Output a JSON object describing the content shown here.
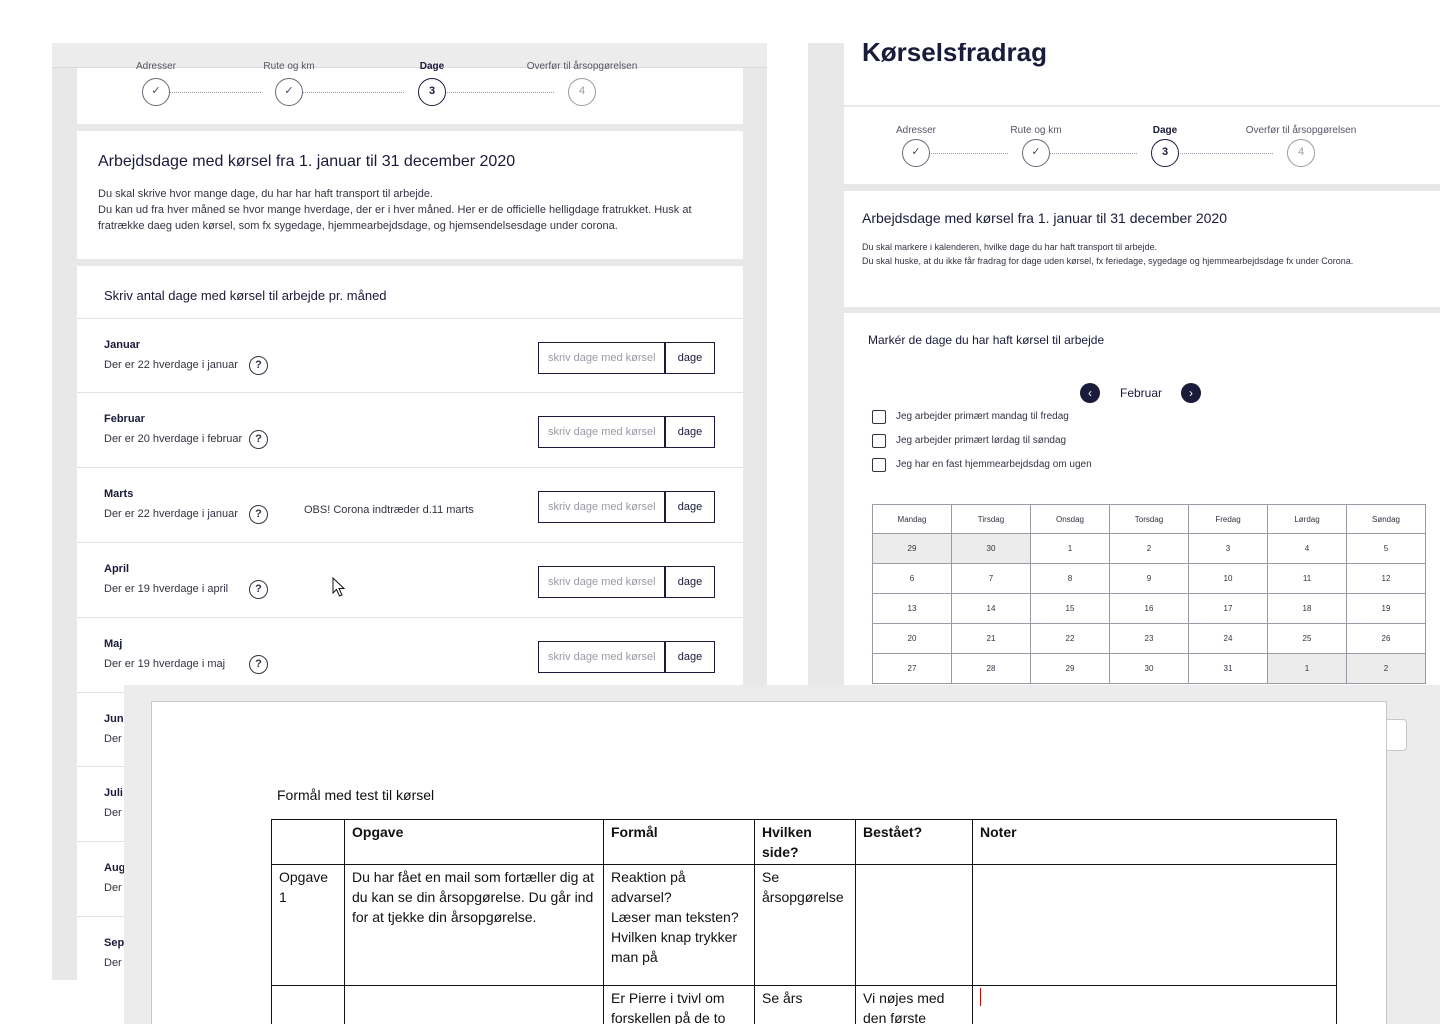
{
  "left": {
    "steps": [
      {
        "label": "Adresser",
        "marker": "✓",
        "state": "done"
      },
      {
        "label": "Rute og km",
        "marker": "✓",
        "state": "done"
      },
      {
        "label": "Dage",
        "marker": "3",
        "state": "current"
      },
      {
        "label": "Overfør til årsopgørelsen",
        "marker": "4",
        "state": "future"
      }
    ],
    "intro_title": "Arbejdsdage med kørsel fra 1. januar til 31 december 2020",
    "intro_line1": "Du skal skrive hvor mange dage, du har har haft transport til arbejde.",
    "intro_line2": "Du kan ud fra hver måned se hvor mange hverdage, der er i hver måned. Her er de officielle helligdage fratrukket. Husk at fratrække daeg uden kørsel, som fx sygedage, hjemmearbejdsdage, og hjemsendelsesdage under corona.",
    "form_title": "Skriv antal dage med kørsel til arbejde pr. måned",
    "input_placeholder": "skriv dage med kørsel",
    "unit_label": "dage",
    "help_glyph": "?",
    "months": [
      {
        "name": "Januar",
        "sub": "Der er 22 hverdage i januar"
      },
      {
        "name": "Februar",
        "sub": "Der er 20 hverdage i februar"
      },
      {
        "name": "Marts",
        "sub": "Der er 22 hverdage i januar",
        "note": "OBS! Corona indtræder d.11 marts"
      },
      {
        "name": "April",
        "sub": "Der er 19 hverdage i april"
      },
      {
        "name": "Maj",
        "sub": "Der er 19 hverdage i maj"
      },
      {
        "name": "Juni",
        "sub": "Der"
      },
      {
        "name": "Juli",
        "sub": "Der"
      },
      {
        "name": "Aug",
        "sub": "Der"
      },
      {
        "name": "Sept",
        "sub": "Der"
      }
    ]
  },
  "right": {
    "page_title": "Kørselsfradrag",
    "steps": [
      {
        "label": "Adresser",
        "marker": "✓",
        "state": "done"
      },
      {
        "label": "Rute og km",
        "marker": "✓",
        "state": "done"
      },
      {
        "label": "Dage",
        "marker": "3",
        "state": "current"
      },
      {
        "label": "Overfør til årsopgørelsen",
        "marker": "4",
        "state": "future"
      }
    ],
    "intro_title": "Arbejdsdage med kørsel fra 1. januar til 31 december 2020",
    "intro_line1": "Du skal markere i kalenderen, hvilke dage du har haft transport til arbejde.",
    "intro_line2": "Du skal huske, at du ikke får fradrag for dage uden kørsel, fx feriedage, sygedage og hjemmearbejdsdage fx under Corona.",
    "calendar_title": "Markér de dage du har haft kørsel til arbejde",
    "month": "Februar",
    "prev_glyph": "‹",
    "next_glyph": "›",
    "options": [
      "Jeg arbejder primært mandag til fredag",
      "Jeg arbejder primært lørdag til søndag",
      "Jeg har en fast hjemmearbejdsdag om ugen"
    ],
    "weekdays": [
      "Mandag",
      "Tirsdag",
      "Onsdag",
      "Torsdag",
      "Fredag",
      "Lørdag",
      "Søndag"
    ],
    "weeks": [
      [
        {
          "d": "29",
          "o": true
        },
        {
          "d": "30",
          "o": true
        },
        {
          "d": "1"
        },
        {
          "d": "2"
        },
        {
          "d": "3"
        },
        {
          "d": "4"
        },
        {
          "d": "5"
        }
      ],
      [
        {
          "d": "6"
        },
        {
          "d": "7"
        },
        {
          "d": "8"
        },
        {
          "d": "9"
        },
        {
          "d": "10"
        },
        {
          "d": "11"
        },
        {
          "d": "12"
        }
      ],
      [
        {
          "d": "13"
        },
        {
          "d": "14"
        },
        {
          "d": "15"
        },
        {
          "d": "16"
        },
        {
          "d": "17"
        },
        {
          "d": "18"
        },
        {
          "d": "19"
        }
      ],
      [
        {
          "d": "20"
        },
        {
          "d": "21"
        },
        {
          "d": "22"
        },
        {
          "d": "23"
        },
        {
          "d": "24"
        },
        {
          "d": "25"
        },
        {
          "d": "26"
        }
      ],
      [
        {
          "d": "27"
        },
        {
          "d": "28"
        },
        {
          "d": "29"
        },
        {
          "d": "30"
        },
        {
          "d": "31"
        },
        {
          "d": "1",
          "o": true
        },
        {
          "d": "2",
          "o": true
        }
      ]
    ]
  },
  "doc": {
    "title": "Formål med test til kørsel",
    "headers": [
      "",
      "Opgave",
      "Formål",
      "Hvilken side?",
      "Bestået?",
      "Noter"
    ],
    "rows": [
      [
        "Opgave 1",
        "Du har fået en mail som fortæller dig at du kan se din årsopgørelse. Du går ind for at tjekke din årsopgørelse.",
        "Reaktion på advarsel?\nLæser man teksten?\nHvilken knap trykker man på",
        "Se årsopgørelse",
        "",
        ""
      ],
      [
        "",
        "",
        "Er Pierre i tvivl om forskellen på de to",
        "Se års",
        "Vi nøjes med den første",
        ""
      ]
    ]
  }
}
